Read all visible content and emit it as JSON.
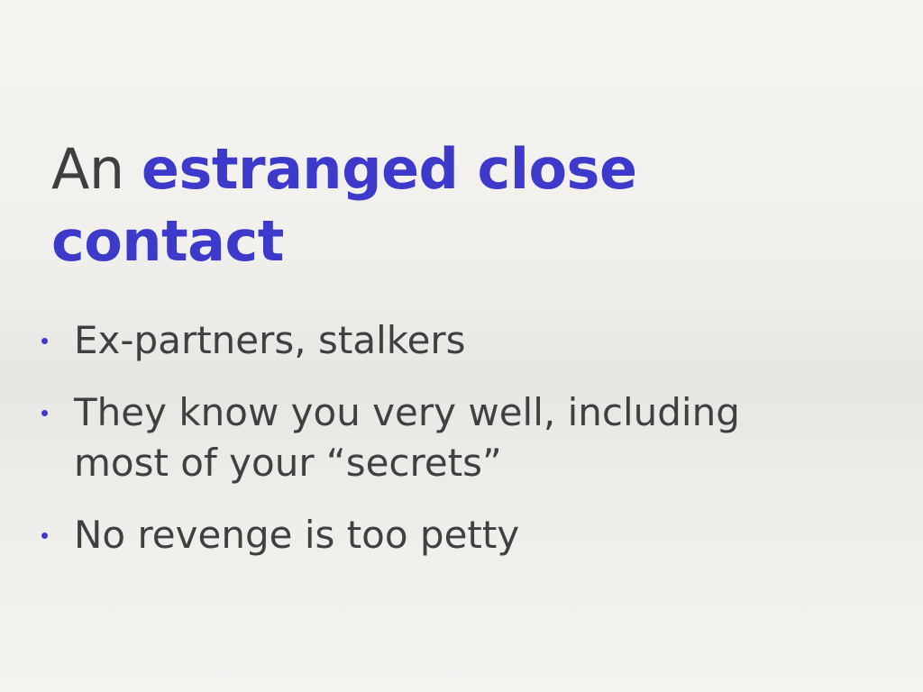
{
  "slide": {
    "title": {
      "plain": "An ",
      "accent": "estranged close contact"
    },
    "bullets": [
      "Ex-partners, stalkers",
      "They know you very well, including most of your “secrets”",
      "No revenge is too petty"
    ],
    "colors": {
      "accent": "#3d3acb",
      "text": "#404040"
    }
  }
}
